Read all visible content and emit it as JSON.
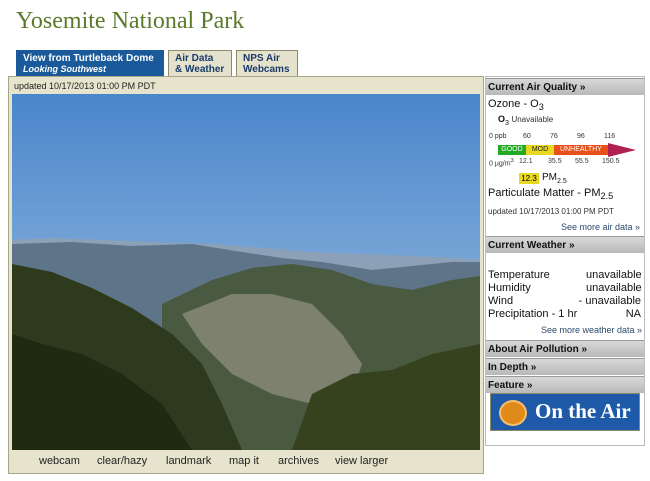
{
  "page": {
    "title": "Yosemite National Park"
  },
  "tabs": [
    {
      "label": "View from Turtleback Dome",
      "sub": "Looking Southwest"
    },
    {
      "label": "Air Data",
      "sub": "& Weather"
    },
    {
      "label": "NPS Air",
      "sub": "Webcams"
    }
  ],
  "webcam": {
    "updated": "updated 10/17/2013 01:00 PM PDT",
    "links": [
      "webcam",
      "clear/hazy",
      "landmark",
      "map it",
      "archives",
      "view larger"
    ]
  },
  "air_quality": {
    "header": "Current Air Quality »",
    "ozone_title": "Ozone - O",
    "ozone_sub": "3",
    "ozone_status_label": "O",
    "ozone_status_sub": "3",
    "ozone_status": "Unavailable",
    "ppb_label": "0 ppb",
    "ppb_ticks": [
      "60",
      "76",
      "96",
      "116"
    ],
    "scale": [
      "GOOD",
      "MOD",
      "UNHEALTHY"
    ],
    "ug_label": "0 µg/m",
    "ug_sup": "3",
    "ug_ticks": [
      "12.1",
      "35.5",
      "55.5",
      "150.5"
    ],
    "pm_value": "12.3",
    "pm_label": "PM",
    "pm_sub": "2.5",
    "pm_title": "Particulate Matter - PM",
    "pm_title_sub": "2.5",
    "pm_updated": "updated 10/17/2013 01:00 PM PDT",
    "more_link": "See more air data »",
    "colors": {
      "good": "#22aa22",
      "mod": "#e8d820",
      "unhealthy": "#e8501a",
      "arrow": "#b02050"
    }
  },
  "weather": {
    "header": "Current Weather »",
    "rows": [
      {
        "label": "Temperature",
        "value": "unavailable"
      },
      {
        "label": "Humidity",
        "value": "unavailable"
      },
      {
        "label": "Wind",
        "value": "- unavailable"
      },
      {
        "label": "Precipitation - 1 hr",
        "value": "NA"
      }
    ],
    "more_link": "See more weather data »"
  },
  "sections": {
    "about": "About Air Pollution »",
    "in_depth": "In Depth »",
    "feature": "Feature »"
  },
  "feature": {
    "label": "On the Air",
    "icon": "rss-icon"
  }
}
